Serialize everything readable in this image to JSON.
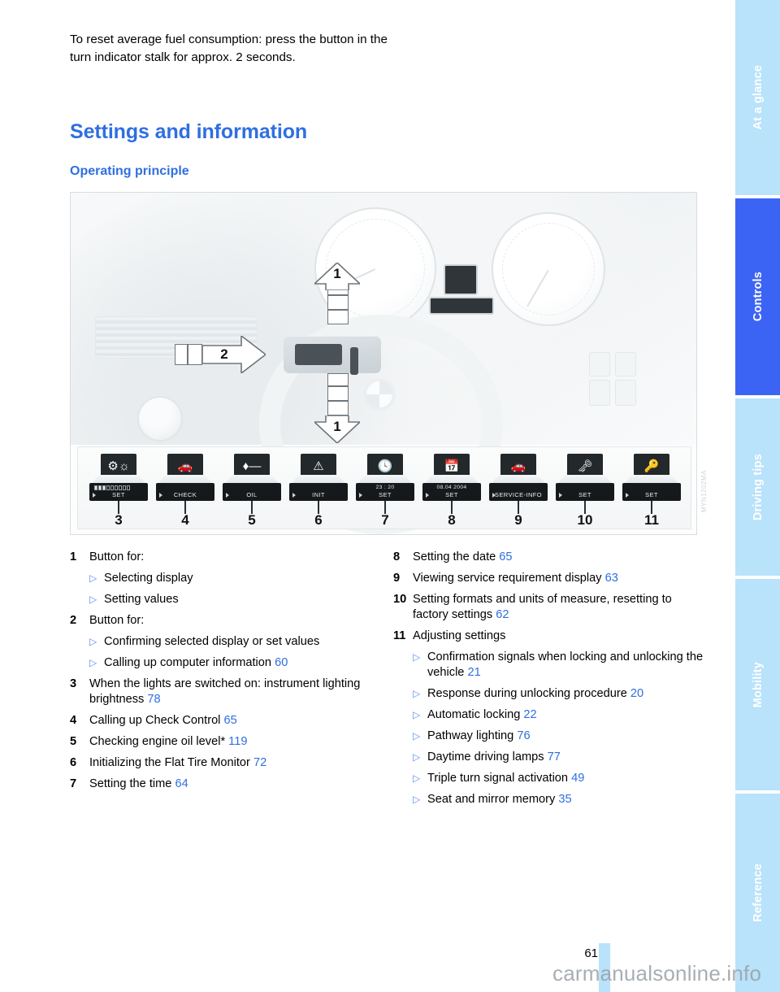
{
  "intro": {
    "paragraph": "To reset average fuel consumption: press the button in the turn indicator stalk for approx. 2 seconds."
  },
  "headings": {
    "section_title": "Settings and information",
    "subsection_title": "Operating principle"
  },
  "colors": {
    "heading_blue": "#2f6fe0",
    "page_ref_blue": "#2f6fe0",
    "tab_active": "#3c64f4",
    "tab_inactive": "#b9e2fb"
  },
  "sidebar": {
    "tabs": [
      {
        "label": "At a glance",
        "active": false
      },
      {
        "label": "Controls",
        "active": true
      },
      {
        "label": "Driving tips",
        "active": false
      },
      {
        "label": "Mobility",
        "active": false
      },
      {
        "label": "Reference",
        "active": false
      }
    ]
  },
  "figure": {
    "code": "MYN1202MA",
    "callouts": [
      {
        "number": "1",
        "direction": "up"
      },
      {
        "number": "2",
        "direction": "right"
      },
      {
        "number": "1",
        "direction": "down"
      }
    ],
    "menu_items": [
      {
        "number": "3",
        "icon": "brightness-gear-icon",
        "display_top": "",
        "display_label": "SET",
        "segments": 9,
        "segments_on": 3
      },
      {
        "number": "4",
        "icon": "car-silhouette-icon",
        "display_top": "",
        "display_label": "CHECK",
        "segments": 0,
        "segments_on": 0
      },
      {
        "number": "5",
        "icon": "oil-can-icon",
        "display_top": "",
        "display_label": "OIL",
        "segments": 0,
        "segments_on": 0
      },
      {
        "number": "6",
        "icon": "tire-pressure-icon",
        "display_top": "",
        "display_label": "INIT",
        "segments": 0,
        "segments_on": 0
      },
      {
        "number": "7",
        "icon": "clock-icon",
        "display_top": "23 : 20",
        "display_label": "SET",
        "segments": 0,
        "segments_on": 0
      },
      {
        "number": "8",
        "icon": "calendar-date-icon",
        "display_top": "08.04 2004",
        "display_label": "SET",
        "segments": 0,
        "segments_on": 0
      },
      {
        "number": "9",
        "icon": "car-service-icon",
        "display_top": "",
        "display_label": "SERVICE-INFO",
        "segments": 0,
        "segments_on": 0
      },
      {
        "number": "10",
        "icon": "key-settings-icon",
        "display_top": "",
        "display_label": "SET",
        "segments": 0,
        "segments_on": 0
      },
      {
        "number": "11",
        "icon": "key-check-icon",
        "display_top": "",
        "display_label": "SET",
        "segments": 0,
        "segments_on": 0
      }
    ]
  },
  "legend": {
    "left": [
      {
        "num": "1",
        "text": "Button for:",
        "page": ""
      },
      {
        "sub": true,
        "text": "Selecting display",
        "page": ""
      },
      {
        "sub": true,
        "text": "Setting values",
        "page": ""
      },
      {
        "num": "2",
        "text": "Button for:",
        "page": ""
      },
      {
        "sub": true,
        "text": "Confirming selected display or set values",
        "page": ""
      },
      {
        "sub": true,
        "text": "Calling up computer information",
        "page": "60"
      },
      {
        "num": "3",
        "text": "When the lights are switched on: instrument lighting brightness",
        "page": "78"
      },
      {
        "num": "4",
        "text": "Calling up Check Control",
        "page": "65"
      },
      {
        "num": "5",
        "text": "Checking engine oil level*",
        "page": "119"
      },
      {
        "num": "6",
        "text": "Initializing the Flat Tire Monitor",
        "page": "72"
      },
      {
        "num": "7",
        "text": "Setting the time",
        "page": "64"
      }
    ],
    "right": [
      {
        "num": "8",
        "text": "Setting the date",
        "page": "65"
      },
      {
        "num": "9",
        "text": "Viewing service requirement display",
        "page": "63"
      },
      {
        "num": "10",
        "text": "Setting formats and units of measure, resetting to factory settings",
        "page": "62"
      },
      {
        "num": "11",
        "text": "Adjusting settings",
        "page": ""
      },
      {
        "sub": true,
        "text": "Confirmation signals when locking and unlocking the vehicle",
        "page": "21"
      },
      {
        "sub": true,
        "text": "Response during unlocking procedure",
        "page": "20"
      },
      {
        "sub": true,
        "text": "Automatic locking",
        "page": "22"
      },
      {
        "sub": true,
        "text": "Pathway lighting",
        "page": "76"
      },
      {
        "sub": true,
        "text": "Daytime driving lamps",
        "page": "77"
      },
      {
        "sub": true,
        "text": "Triple turn signal activation",
        "page": "49"
      },
      {
        "sub": true,
        "text": "Seat and mirror memory",
        "page": "35"
      }
    ]
  },
  "footer": {
    "page_number": "61",
    "watermark": "carmanualsonline.info"
  }
}
